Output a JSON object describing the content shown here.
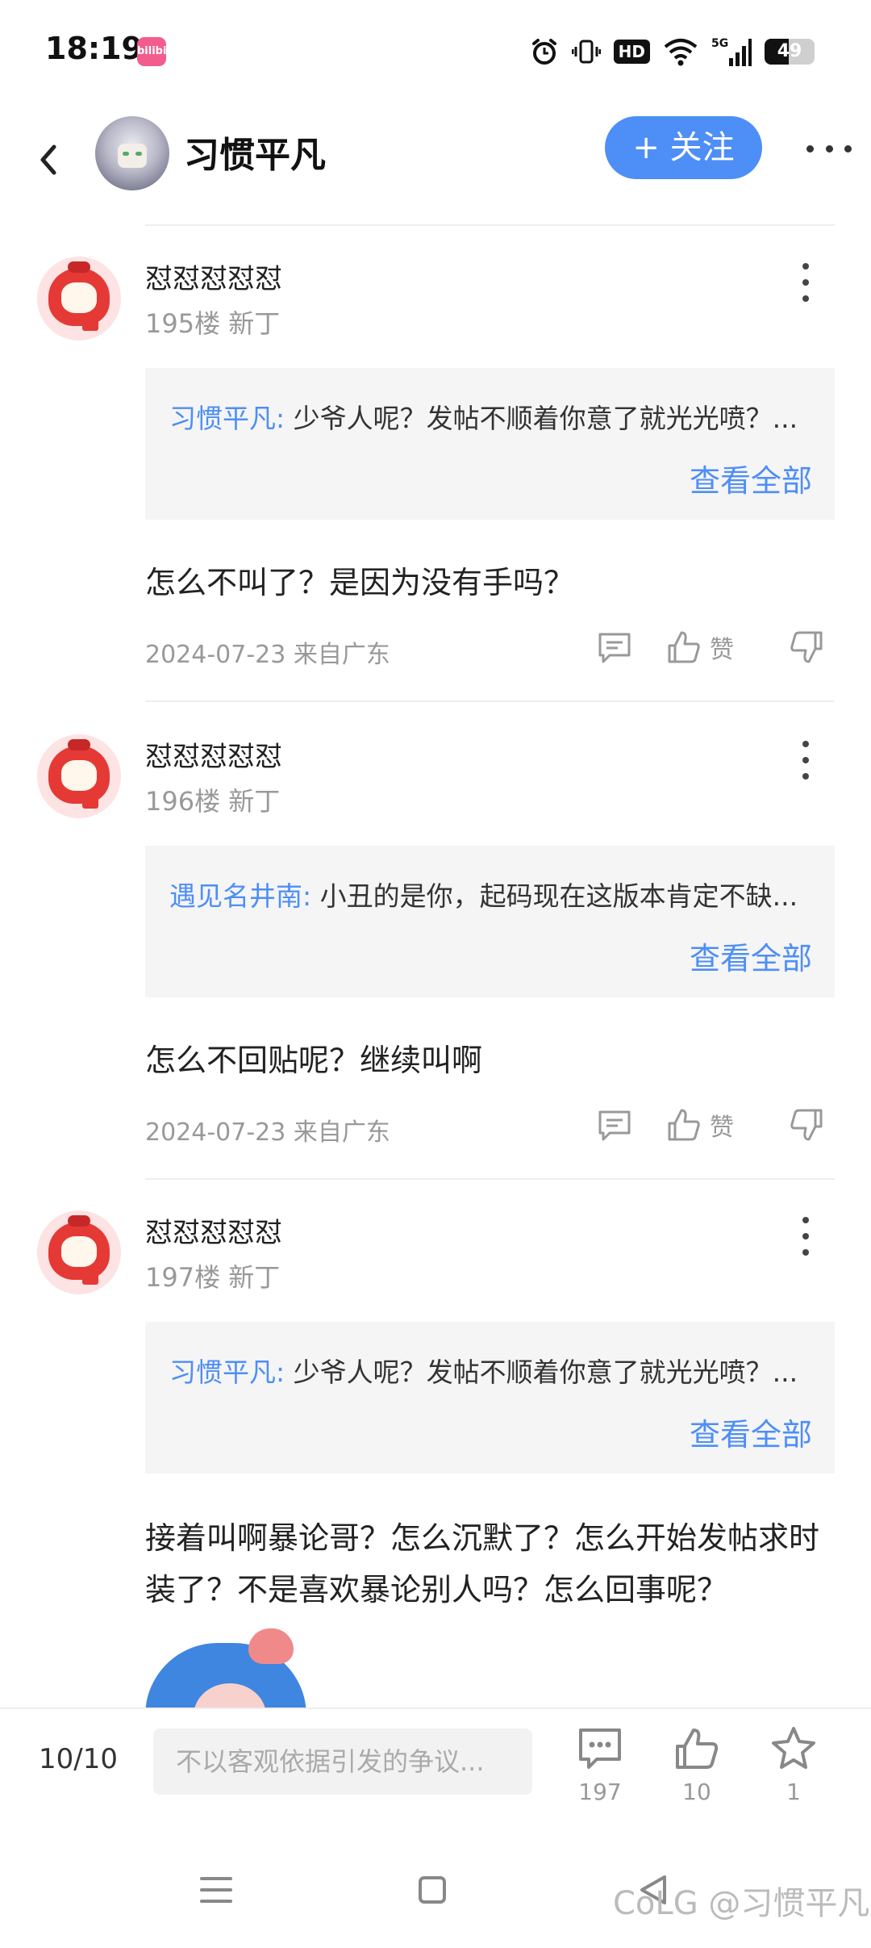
{
  "status_bar": {
    "time": "18:19",
    "app_badge": "bilibili",
    "network": "5G",
    "hd_label": "HD",
    "battery_percent": 49,
    "battery_label": "49",
    "icons": [
      "alarm-icon",
      "vibrate-icon",
      "hd-icon",
      "wifi-icon",
      "signal-icon",
      "battery-icon"
    ]
  },
  "header": {
    "name": "习惯平凡",
    "follow_label": "+ 关注",
    "accent_color": "#4e8ef7"
  },
  "comments": [
    {
      "user": "怼怼怼怼怼",
      "floor": "195楼 新丁",
      "quote_author": "习惯平凡:",
      "quote_text": " 少爷人呢？发帖不顺着你意了就光光喷？",
      "quote_ellipsis": "...",
      "view_all": "查看全部",
      "text": "怎么不叫了？是因为没有手吗？",
      "meta": "2024-07-23 来自广东",
      "like_label": "赞"
    },
    {
      "user": "怼怼怼怼怼",
      "floor": "196楼 新丁",
      "quote_author": "遇见名井南:",
      "quote_text": " 小丑的是你，起码现在这版本肯定不缺",
      "quote_ellipsis": "...",
      "view_all": "查看全部",
      "text": "怎么不回贴呢？继续叫啊",
      "meta": "2024-07-23 来自广东",
      "like_label": "赞"
    },
    {
      "user": "怼怼怼怼怼",
      "floor": "197楼 新丁",
      "quote_author": "习惯平凡:",
      "quote_text": " 少爷人呢？发帖不顺着你意了就光光喷？",
      "quote_ellipsis": "...",
      "view_all": "查看全部",
      "text": "接着叫啊暴论哥？怎么沉默了？怎么开始发帖求时装了？不是喜欢暴论别人吗？怎么回事呢？"
    }
  ],
  "bottom_bar": {
    "page_indicator": "10/10",
    "input_placeholder": "不以客观依据引发的争议...",
    "comment_count": "197",
    "like_count": "10",
    "star_count": "1"
  },
  "nav": {
    "watermark": "@习惯平凡",
    "watermark_logo": "CoLG"
  }
}
